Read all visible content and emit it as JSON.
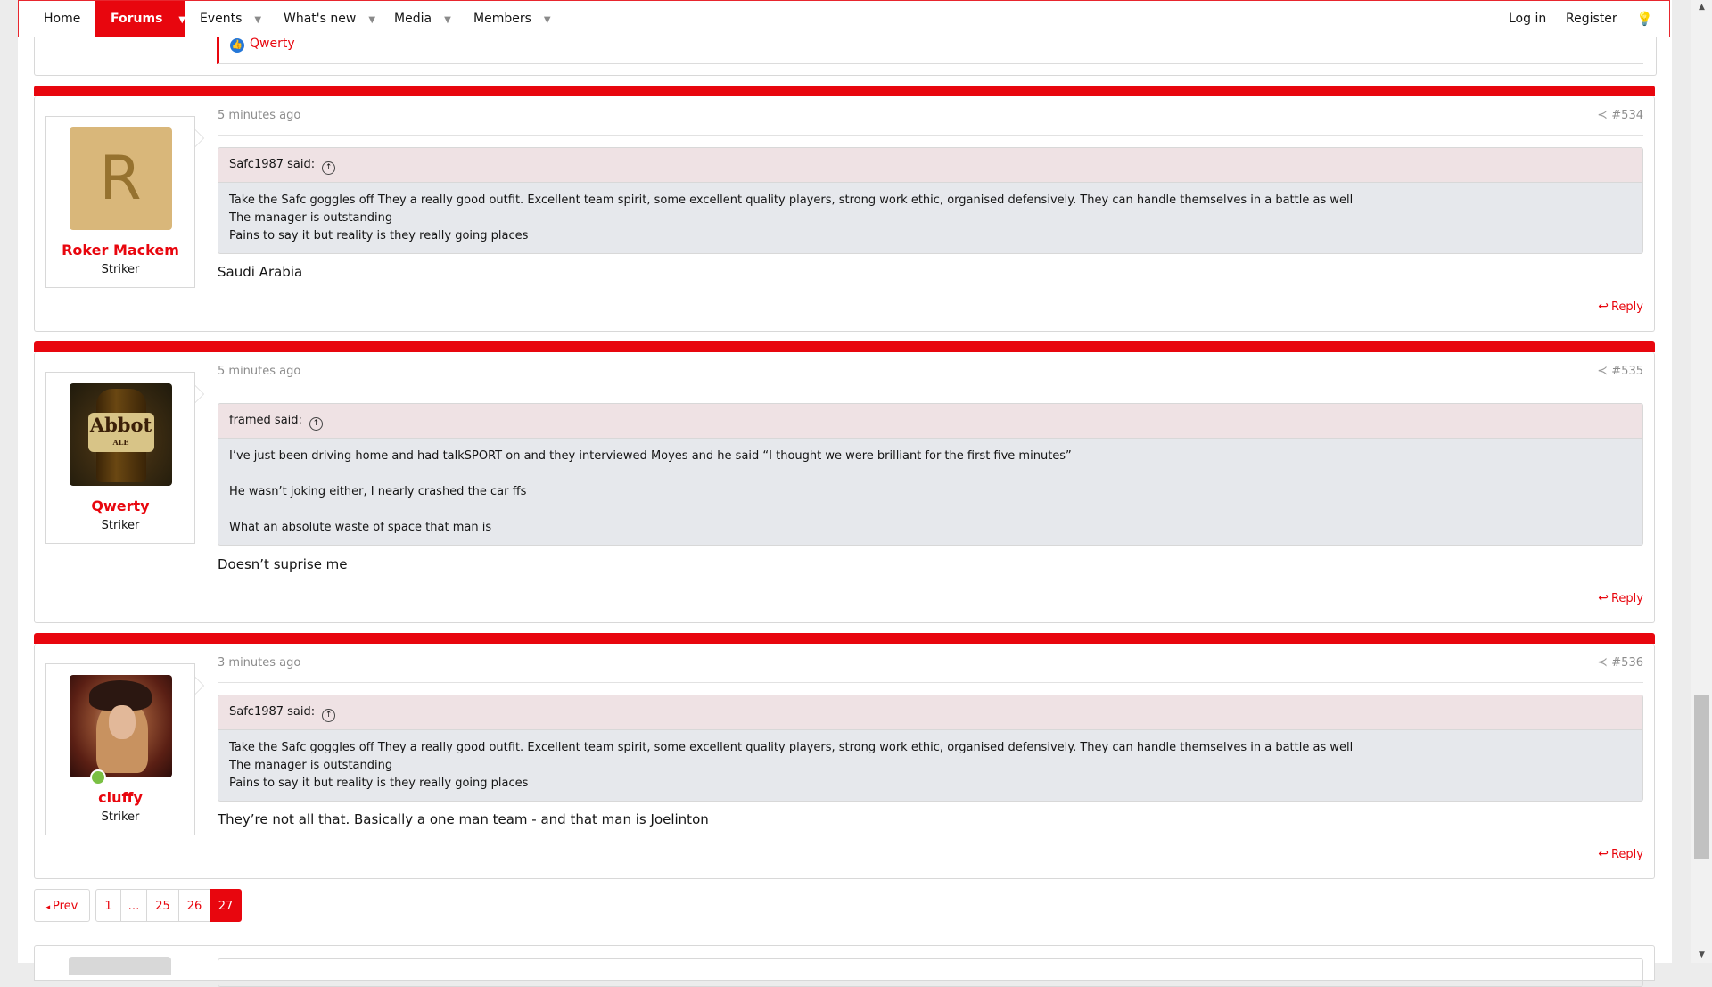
{
  "nav": {
    "items": [
      {
        "label": "Home"
      },
      {
        "label": "Forums"
      },
      {
        "label": "Events"
      },
      {
        "label": "What's new"
      },
      {
        "label": "Media"
      },
      {
        "label": "Members"
      }
    ],
    "login": "Log in",
    "register": "Register"
  },
  "prev_post": {
    "reaction_user": "Qwerty"
  },
  "posts": [
    {
      "user": {
        "avatar_letter": "R",
        "name": "Roker Mackem",
        "title": "Striker"
      },
      "date": "5 minutes ago",
      "number": "#534",
      "quote": {
        "author": "Safc1987 said:",
        "lines": [
          "Take the Safc goggles off They a really good outfit. Excellent team spirit, some excellent quality players, strong work ethic, organised defensively. They can handle themselves in a battle as well",
          "The manager is outstanding",
          "Pains to say it but reality is they really going places"
        ]
      },
      "body": "Saudi Arabia",
      "reply": "Reply"
    },
    {
      "user": {
        "avatar_text": "Abbot",
        "avatar_sub": "ALE",
        "name": "Qwerty",
        "title": "Striker"
      },
      "date": "5 minutes ago",
      "number": "#535",
      "quote": {
        "author": "framed said:",
        "lines": [
          "I’ve just been driving home and had talkSPORT on and they interviewed Moyes and he said “I thought we were brilliant for the first five minutes”",
          "He wasn’t joking either, I nearly crashed the car ffs",
          "What an absolute waste of space that man is"
        ]
      },
      "body": "Doesn’t suprise me",
      "reply": "Reply"
    },
    {
      "user": {
        "name": "cluffy",
        "title": "Striker",
        "online": true
      },
      "date": "3 minutes ago",
      "number": "#536",
      "quote": {
        "author": "Safc1987 said:",
        "lines": [
          "Take the Safc goggles off They a really good outfit. Excellent team spirit, some excellent quality players, strong work ethic, organised defensively. They can handle themselves in a battle as well",
          "The manager is outstanding",
          "Pains to say it but reality is they really going places"
        ]
      },
      "body": "They’re not all that. Basically a one man team - and that man is Joelinton",
      "reply": "Reply"
    }
  ],
  "pagination": {
    "prev": "Prev",
    "pages": [
      "1",
      "…",
      "25",
      "26",
      "27"
    ],
    "current": "27"
  },
  "colors": {
    "accent": "#e8060e",
    "quote_header": "#efe2e4",
    "quote_body": "#e6e8ec"
  }
}
